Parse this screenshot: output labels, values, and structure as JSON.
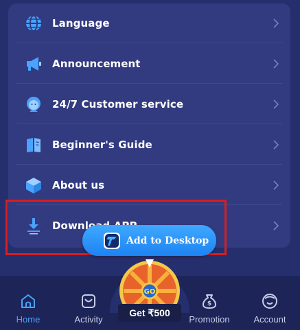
{
  "menu": {
    "items": [
      {
        "label": "Language",
        "icon": "globe-icon"
      },
      {
        "label": "Announcement",
        "icon": "megaphone-icon"
      },
      {
        "label": "24/7 Customer service",
        "icon": "support-agent-icon"
      },
      {
        "label": "Beginner's Guide",
        "icon": "book-icon"
      },
      {
        "label": "About us",
        "icon": "cube-icon"
      },
      {
        "label": "Download APP",
        "icon": "download-icon"
      }
    ]
  },
  "add_to_desktop": {
    "label": "Add to Desktop",
    "icon": "app-logo-icon"
  },
  "promo": {
    "label": "Get ₹500",
    "wheel_text": "GO",
    "icon": "spin-wheel-icon"
  },
  "tabbar": {
    "tabs": [
      {
        "label": "Home",
        "icon": "home-icon",
        "active": true
      },
      {
        "label": "Activity",
        "icon": "gift-bag-icon",
        "active": false
      },
      {
        "label": "Promotion",
        "icon": "money-bag-icon",
        "active": false
      },
      {
        "label": "Account",
        "icon": "user-face-icon",
        "active": false
      }
    ]
  },
  "colors": {
    "background": "#262f6d",
    "card": "#323a80",
    "accent": "#4aa3ff",
    "highlight_border": "#d71f1f",
    "tabbar": "#1c2458"
  }
}
